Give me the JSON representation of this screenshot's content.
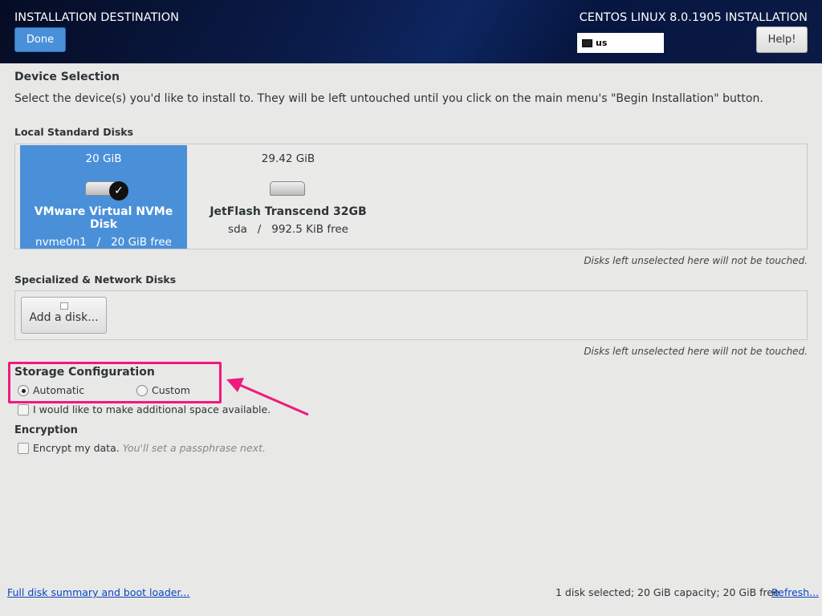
{
  "header": {
    "title": "INSTALLATION DESTINATION",
    "product": "CENTOS LINUX 8.0.1905 INSTALLATION",
    "done_label": "Done",
    "keyboard_layout": "us",
    "help_label": "Help!"
  },
  "device_selection": {
    "heading": "Device Selection",
    "description": "Select the device(s) you'd like to install to.  They will be left untouched until you click on the main menu's \"Begin Installation\" button."
  },
  "local_disks": {
    "heading": "Local Standard Disks",
    "disks": [
      {
        "size": "20 GiB",
        "name": "VMware Virtual NVMe Disk",
        "device": "nvme0n1",
        "free": "20 GiB free",
        "selected": true
      },
      {
        "size": "29.42 GiB",
        "name": "JetFlash Transcend 32GB",
        "device": "sda",
        "free": "992.5 KiB free",
        "selected": false
      }
    ],
    "note": "Disks left unselected here will not be touched."
  },
  "specialized": {
    "heading": "Specialized & Network Disks",
    "add_label": "Add a disk...",
    "note": "Disks left unselected here will not be touched."
  },
  "storage": {
    "heading": "Storage Configuration",
    "automatic": "Automatic",
    "custom": "Custom",
    "selected": "Automatic",
    "additional_space": "I would like to make additional space available."
  },
  "encryption": {
    "heading": "Encryption",
    "label": "Encrypt my data.",
    "hint": "You'll set a passphrase next."
  },
  "footer": {
    "summary_link": "Full disk summary and boot loader...",
    "status": "1 disk selected; 20 GiB capacity; 20 GiB free",
    "refresh": "Refresh..."
  },
  "colors": {
    "accent": "#4a90d9",
    "highlight": "#f0197d"
  }
}
